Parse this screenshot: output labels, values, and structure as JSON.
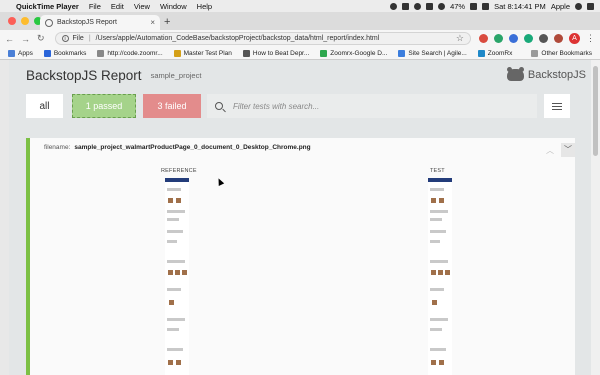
{
  "menubar": {
    "app": "QuickTime Player",
    "items": [
      "File",
      "Edit",
      "View",
      "Window",
      "Help"
    ],
    "battery": "47%",
    "clock": "Sat 8:14:41 PM",
    "user": "Apple"
  },
  "browser": {
    "tab_title": "BackstopJS Report",
    "url_scheme": "File",
    "url": "/Users/apple/Automation_CodeBase/backstopProject/backstop_data/html_report/index.html",
    "profile_initial": "A"
  },
  "bookmarks": {
    "items": [
      {
        "label": "Apps",
        "color": "#4a7fd6"
      },
      {
        "label": "Bookmarks",
        "color": "#2b65d9"
      },
      {
        "label": "http://code.zoomr...",
        "color": "#888888"
      },
      {
        "label": "Master Test Plan",
        "color": "#d4a017"
      },
      {
        "label": "How to Beat Depr...",
        "color": "#555555"
      },
      {
        "label": "Zoomrx-Google D...",
        "color": "#2fa84f"
      },
      {
        "label": "Site Search | Agile...",
        "color": "#3b7ddd"
      },
      {
        "label": "ZoomRx",
        "color": "#1e88c8"
      }
    ],
    "other": "Other Bookmarks"
  },
  "report": {
    "brand": "BackstopJS Report",
    "project": "sample_project",
    "logo_text": "BackstopJS",
    "filter_all": "all",
    "filter_passed": "1 passed",
    "filter_failed": "3 failed",
    "search_placeholder": "Filter tests with search...",
    "filename_label": "filename:",
    "filename": "sample_project_walmartProductPage_0_document_0_Desktop_Chrome.png",
    "reference_label": "REFERENCE",
    "test_label": "TEST"
  },
  "colors": {
    "passed": "#a5d38a",
    "failed": "#e38c8c",
    "accent_border": "#7cc045"
  }
}
